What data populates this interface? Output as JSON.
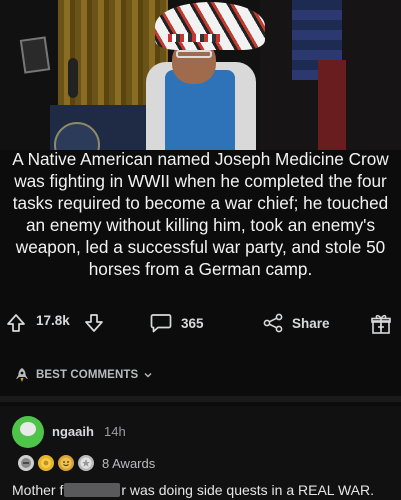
{
  "post": {
    "caption": "A Native American named Joseph Medicine Crow was fighting in WWII when he completed the four tasks required to become a war chief; he touched an enemy without killing him, took an enemy's weapon, led a successful war party, and stole 50 horses from a German camp."
  },
  "actions": {
    "upvote_count": "17.8k",
    "comment_count": "365",
    "share_label": "Share"
  },
  "comments_header": {
    "sort_label": "BEST COMMENTS"
  },
  "comment": {
    "username": "ngaaih",
    "age": "14h",
    "awards_label": "8 Awards",
    "text_before": "Mother f",
    "text_after": "r was doing side quests in a REAL WAR."
  },
  "colors": {
    "background": "#0c0c0c",
    "avatar": "#4ec54a",
    "text": "#d7dadc"
  }
}
